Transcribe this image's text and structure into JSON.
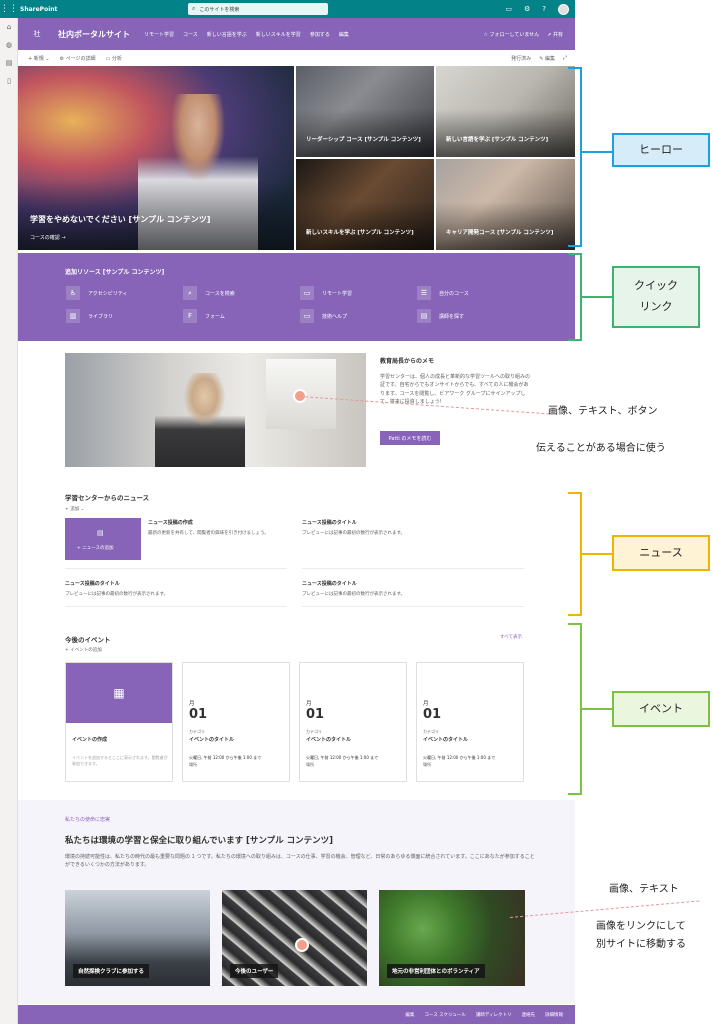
{
  "suite": {
    "app_name": "SharePoint",
    "search_placeholder": "このサイトを検索",
    "waffle_icon": "waffle-icon"
  },
  "rail": [
    "home-icon",
    "globe-icon",
    "feed-icon",
    "page-icon"
  ],
  "site": {
    "title": "社内ポータルサイト",
    "logo": "社",
    "nav": [
      "リモート学習",
      "コース",
      "新しい言語を学ぶ",
      "新しいスキルを学習",
      "参加する",
      "編集"
    ],
    "follow": "フォローしていません",
    "share": "共有"
  },
  "command": {
    "new": "新規",
    "page_details": "ページの詳細",
    "analytics": "分析",
    "published": "発行済み",
    "edit": "編集"
  },
  "hero": {
    "main_title": "学習をやめないでください [サンプル コンテンツ]",
    "main_link": "コースの確認 →",
    "tiles": [
      "リーダーシップ コース [サンプル コンテンツ]",
      "新しい言語を学ぶ [サンプル コンテンツ]",
      "新しいスキルを学ぶ [サンプル コンテンツ]",
      "キャリア開発コース [サンプル コンテンツ]"
    ]
  },
  "quick_links": {
    "title": "追加リソース [サンプル コンテンツ]",
    "items": [
      {
        "label": "アクセシビリティ",
        "icon": "accessibility-icon"
      },
      {
        "label": "コースを検索",
        "icon": "search-icon"
      },
      {
        "label": "リモート学習",
        "icon": "laptop-icon"
      },
      {
        "label": "自分のコース",
        "icon": "list-icon"
      },
      {
        "label": "ライブラリ",
        "icon": "library-icon"
      },
      {
        "label": "フォーム",
        "icon": "forms-icon"
      },
      {
        "label": "技術ヘルプ",
        "icon": "laptop-icon"
      },
      {
        "label": "講師を探す",
        "icon": "document-icon"
      }
    ]
  },
  "memo": {
    "title": "教育局長からのメモ",
    "body": "学習センターは、個人の成長と革新的な学習ツールへの取り組みの証です。自宅からでもオンサイトからでも、すべての人に機会があります。コースを閲覧し、ビアワーク グループにサインアップして、将来に投資しましょう!",
    "button": "Patti のメモを読む"
  },
  "news": {
    "title": "学習センターからのニュース",
    "add": "+ 追加 ⌄",
    "add_news": "+ ニュースの追加",
    "items": [
      {
        "title": "ニュース投稿の作成",
        "desc": "最新の更新を共有して、閲覧者の興味を引き付けましょう。"
      },
      {
        "title": "ニュース投稿のタイトル",
        "desc": "プレビューには記事の最初の数行が表示されます。"
      },
      {
        "title": "ニュース投稿のタイトル",
        "desc": "プレビューには記事の最初の数行が表示されます。"
      },
      {
        "title": "ニュース投稿のタイトル",
        "desc": "プレビューには記事の最初の数行が表示されます。"
      }
    ]
  },
  "events": {
    "title": "今後のイベント",
    "add": "+ イベントの追加",
    "see_all": "すべて表示",
    "create_title": "イベントの作成",
    "create_desc": "イベントを追加するとここに表示されます。閲覧者が参加できます。",
    "cards": [
      {
        "month": "月",
        "day": "01",
        "category": "カテゴリ",
        "title": "イベントのタイトル",
        "time": "火曜日, 午前 12:00 から午後 1:00 まで",
        "location": "場所"
      },
      {
        "month": "月",
        "day": "01",
        "category": "カテゴリ",
        "title": "イベントのタイトル",
        "time": "火曜日, 午前 12:00 から午後 1:00 まで",
        "location": "場所"
      },
      {
        "month": "月",
        "day": "01",
        "category": "カテゴリ",
        "title": "イベントのタイトル",
        "time": "火曜日, 午前 12:00 から午後 1:00 まで",
        "location": "場所"
      }
    ]
  },
  "mission": {
    "kicker": "私たちの使命に忠実",
    "title": "私たちは環境の学習と保全に取り組んでいます [サンプル コンテンツ]",
    "body": "環境の持続可能性は、私たちの時代の最も重要な問題の 1 つです。私たちの環境への取り組みは、コースの仕事、学習の機会、管理など、日常のあらゆる側面に統合されています。ここにあなたが参加することができるいくつかの方法があります。",
    "cards": [
      "自然探検クラブに参加する",
      "今後のユーザー",
      "地元の非営利団体とのボランティア"
    ]
  },
  "footer": [
    "編集",
    "コース スケジュール",
    "講師ディレクトリ",
    "連絡先",
    "詳細情報"
  ],
  "annotations": {
    "hero": "ヒーロー",
    "quick_1": "クイック",
    "quick_2": "リンク",
    "memo_1": "画像、テキスト、ボタン",
    "memo_2": "伝えることがある場合に使う",
    "news": "ニュース",
    "events": "イベント",
    "mission_1": "画像、テキスト",
    "mission_2": "画像をリンクにして",
    "mission_3": "別サイトに移動する"
  },
  "colors": {
    "suite": "#038387",
    "accent": "#8764b8",
    "hero_annotation": "#1ba1e2",
    "quick_annotation": "#3cb371",
    "news_annotation": "#f0b400",
    "events_annotation": "#7cc242"
  }
}
